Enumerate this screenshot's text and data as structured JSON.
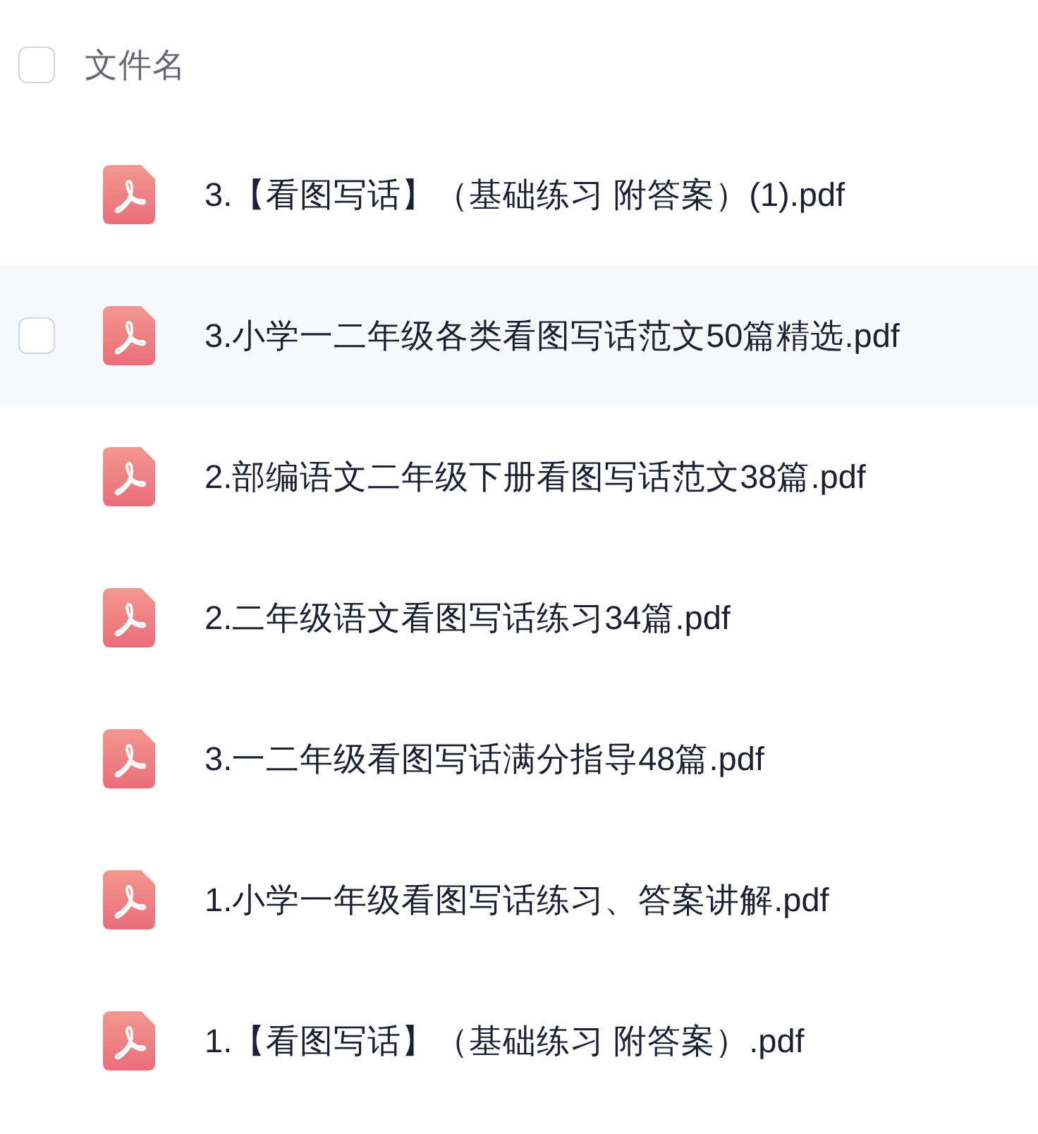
{
  "header": {
    "checked": false,
    "label": "文件名"
  },
  "rows": [
    {
      "name": "3.【看图写话】（基础练习 附答案）(1).pdf",
      "highlighted": false,
      "checked": false
    },
    {
      "name": "3.小学一二年级各类看图写话范文50篇精选.pdf",
      "highlighted": true,
      "checked": false
    },
    {
      "name": "2.部编语文二年级下册看图写话范文38篇.pdf",
      "highlighted": false,
      "checked": false
    },
    {
      "name": "2.二年级语文看图写话练习34篇.pdf",
      "highlighted": false,
      "checked": false
    },
    {
      "name": "3.一二年级看图写话满分指导48篇.pdf",
      "highlighted": false,
      "checked": false
    },
    {
      "name": "1.小学一年级看图写话练习、答案讲解.pdf",
      "highlighted": false,
      "checked": false
    },
    {
      "name": "1.【看图写话】（基础练习 附答案）.pdf",
      "highlighted": false,
      "checked": false
    }
  ]
}
